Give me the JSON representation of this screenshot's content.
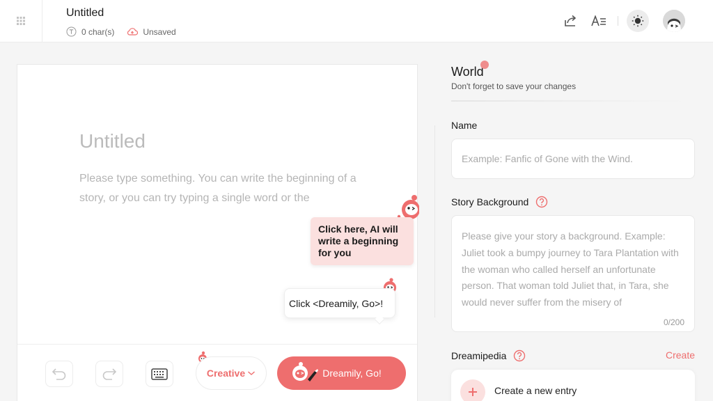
{
  "header": {
    "doc_title": "Untitled",
    "char_count": "0 char(s)",
    "save_status": "Unsaved"
  },
  "editor": {
    "title_placeholder": "Untitled",
    "body_placeholder": "Please type something. You can write the beginning of a story, or you can try typing a single word or the",
    "ai_tip": "Click here, AI will write a beginning for you",
    "go_tip": "Click <Dreamily, Go>!"
  },
  "toolbar": {
    "mode_label": "Creative",
    "go_label": "Dreamily, Go!"
  },
  "panel": {
    "title": "World",
    "subtitle": "Don't forget to save your changes",
    "name_label": "Name",
    "name_placeholder": "Example: Fanfic of Gone with the Wind.",
    "background_label": "Story Background",
    "background_placeholder": "Please give your story a background. Example: Juliet took a bumpy journey to Tara Plantation with the woman who called herself an unfortunate person. That woman told Juliet that, in Tara, she would never suffer from the misery of",
    "counter": "0/200",
    "dreamipedia_label": "Dreamipedia",
    "create_label": "Create",
    "new_entry_label": "Create a new entry"
  },
  "colors": {
    "accent": "#ee6e6e",
    "tip_bg": "#fbe0df"
  },
  "icons": [
    "grid-icon",
    "text-icon",
    "cloud-unsaved-icon",
    "share-icon",
    "font-settings-icon",
    "sun-icon",
    "undo-icon",
    "redo-icon",
    "keyboard-icon",
    "chevron-down-icon",
    "help-icon",
    "plus-icon"
  ]
}
